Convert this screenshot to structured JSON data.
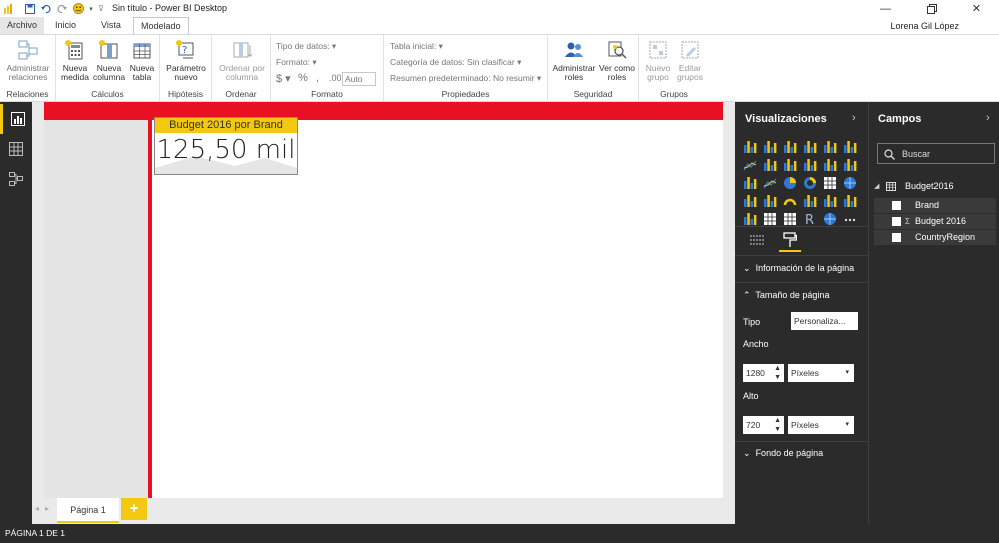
{
  "app": {
    "title": "Sin título - Power BI Desktop",
    "user": "Lorena Gil López"
  },
  "tabs": [
    {
      "label": "Archivo"
    },
    {
      "label": "Inicio"
    },
    {
      "label": "Vista"
    },
    {
      "label": "Modelado"
    }
  ],
  "ribbon": {
    "relaciones": {
      "btn": "Administrar relaciones",
      "btn1": "Administrar",
      "btn2": "relaciones",
      "group": "Relaciones"
    },
    "calculos": {
      "b1a": "Nueva",
      "b1b": "medida",
      "b2a": "Nueva",
      "b2b": "columna",
      "b3a": "Nueva",
      "b3b": "tabla",
      "group": "Cálculos"
    },
    "hipotesis": {
      "b1a": "Parámetro",
      "b1b": "nuevo",
      "group": "Hipótesis"
    },
    "ordenar": {
      "b1a": "Ordenar por",
      "b1b": "columna",
      "group": "Ordenar"
    },
    "formato": {
      "tipo": "Tipo de datos:",
      "formato": "Formato:",
      "auto": "Auto",
      "group": "Formato"
    },
    "propiedades": {
      "tabla": "Tabla inicial:",
      "categoria": "Categoría de datos: Sin clasificar",
      "resumen": "Resumen predeterminado: No resumir",
      "group": "Propiedades"
    },
    "seguridad": {
      "b1a": "Administrar",
      "b1b": "roles",
      "b2a": "Ver como",
      "b2b": "roles",
      "group": "Seguridad"
    },
    "grupos": {
      "b1a": "Nuevo",
      "b1b": "grupo",
      "b2a": "Editar",
      "b2b": "grupos",
      "group": "Grupos"
    }
  },
  "card": {
    "title": "Budget 2016 por Brand",
    "value": "125,50 mil"
  },
  "pages": {
    "tab1": "Página 1",
    "add": "+"
  },
  "status": "PÁGINA 1 DE 1",
  "viz": {
    "header": "Visualizaciones",
    "sections": {
      "info": "Información de la página",
      "size": "Tamaño de página",
      "bg": "Fondo de página"
    },
    "tipo_label": "Tipo",
    "tipo_value": "Personaliza...",
    "ancho_label": "Ancho",
    "ancho_value": "1280",
    "ancho_unit": "Píxeles",
    "alto_label": "Alto",
    "alto_value": "720",
    "alto_unit": "Píxeles"
  },
  "fields": {
    "header": "Campos",
    "search_placeholder": "Buscar",
    "table": "Budget2016",
    "items": [
      {
        "label": "Brand"
      },
      {
        "label": "Budget 2016"
      },
      {
        "label": "CountryRegion"
      }
    ]
  },
  "colors": {
    "accent": "#f2c811",
    "red": "#e81123",
    "dark": "#2b2b2b"
  }
}
